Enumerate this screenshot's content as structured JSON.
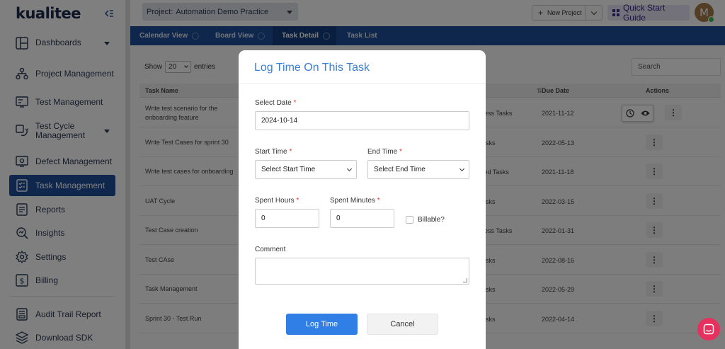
{
  "brand": {
    "logo": "kualitee",
    "accent": "#1f4f99"
  },
  "sidebar": {
    "items": [
      {
        "label": "Dashboards",
        "has_caret": true,
        "icon": "dashboard-icon"
      },
      {
        "label": "Project Management",
        "icon": "project-management-icon"
      },
      {
        "label": "Test Management",
        "icon": "test-management-icon"
      },
      {
        "label": "Test Cycle Management",
        "has_caret": true,
        "icon": "test-cycle-icon"
      },
      {
        "label": "Defect Management",
        "icon": "defect-icon"
      },
      {
        "label": "Task Management",
        "active": true,
        "icon": "task-icon"
      },
      {
        "label": "Reports",
        "icon": "reports-icon"
      },
      {
        "label": "Insights",
        "icon": "insights-icon"
      },
      {
        "label": "Settings",
        "icon": "gear-icon"
      },
      {
        "label": "Billing",
        "icon": "billing-icon"
      },
      {
        "label": "Audit Trail Report",
        "icon": "audit-icon"
      },
      {
        "label": "Download SDK",
        "icon": "download-sdk-icon"
      }
    ]
  },
  "topbar": {
    "project_label": "Project:",
    "project_value": "Automation Demo Practice",
    "new_project": "New Project",
    "quick_start": "Quick Start Guide",
    "avatar_initial": "M"
  },
  "tabs": [
    {
      "label": "Calendar View"
    },
    {
      "label": "Board View"
    },
    {
      "label": "Task Detail",
      "active": true
    },
    {
      "label": "Task List"
    }
  ],
  "table": {
    "show_label": "Show",
    "entries_value": "20",
    "entries_label": "entries",
    "search_placeholder": "Search",
    "headers": {
      "name": "Task Name",
      "due": "Due Date",
      "actions": "Actions"
    },
    "rows": [
      {
        "name": "Write test scenario for the onboarding feature",
        "status": "ress Tasks",
        "due": "2021-11-12"
      },
      {
        "name": "Write Test Cases for sprint 30",
        "status": "asks",
        "due": "2022-05-13"
      },
      {
        "name": "Write test cases for onboarding",
        "status": "ted Tasks",
        "due": "2021-11-18"
      },
      {
        "name": "UAT Cycle",
        "status": "asks",
        "due": "2022-03-15"
      },
      {
        "name": "Test Case creation",
        "status": "ress Tasks",
        "due": "2022-01-31"
      },
      {
        "name": "Test CAse",
        "status": "asks",
        "due": "2022-08-16"
      },
      {
        "name": "Task Management",
        "status": "asks",
        "due": "2022-05-29"
      },
      {
        "name": "Sprint 30 - Test Run",
        "status": "asks",
        "due": "2022-04-14"
      }
    ]
  },
  "modal": {
    "title": "Log Time On This Task",
    "date_label": "Select Date",
    "date_value": "2024-10-14",
    "start_label": "Start Time",
    "start_value": "Select Start Time",
    "end_label": "End Time",
    "end_value": "Select End Time",
    "hours_label": "Spent Hours",
    "hours_value": "0",
    "minutes_label": "Spent Minutes",
    "minutes_value": "0",
    "billable_label": "Billable?",
    "comment_label": "Comment",
    "submit": "Log Time",
    "cancel": "Cancel",
    "required_mark": "*"
  }
}
